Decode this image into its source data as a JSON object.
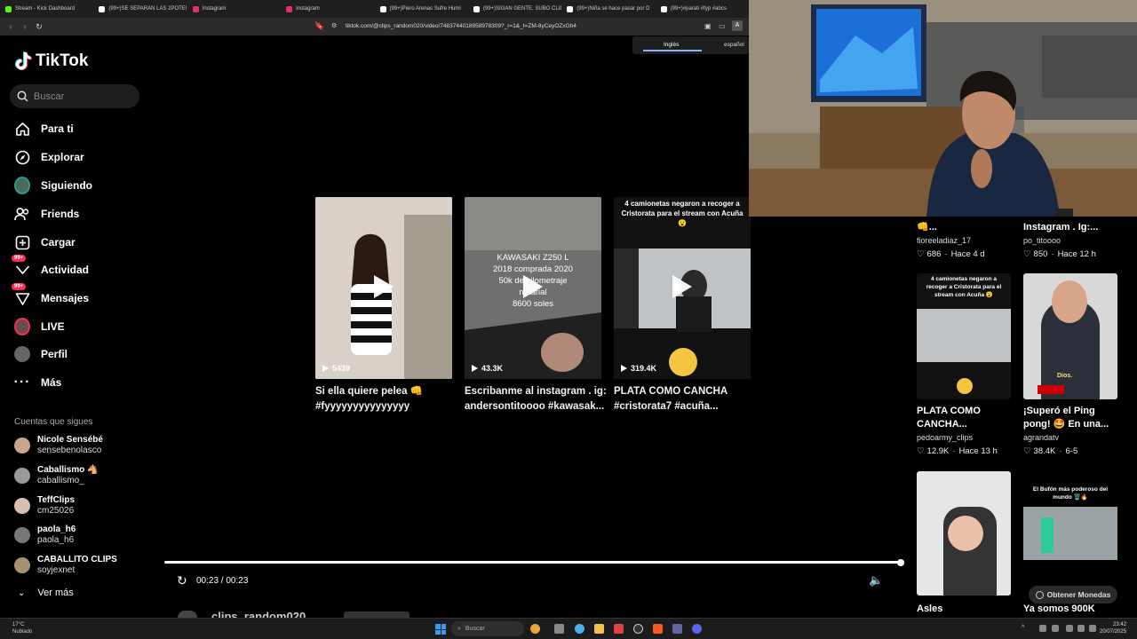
{
  "browser": {
    "tabs": [
      {
        "label": "Stream - Kick Dashboard",
        "color": "#53fc18"
      },
      {
        "label": "(99+)SE SEPARAN LAS 2POTE!!",
        "color": "#ffffff"
      },
      {
        "label": "Instagram",
        "color": "#e1306c"
      },
      {
        "label": "Instagram",
        "color": "#e1306c"
      },
      {
        "label": "(99+)Piero Arenas Sufre Humi",
        "color": "#ffffff"
      },
      {
        "label": "(99+)SIGAN GENTE, SUBO CLIP",
        "color": "#ffffff"
      },
      {
        "label": "(99+)Niña se hace pasar por D",
        "color": "#ffffff"
      },
      {
        "label": "(99+)#parati #fyp #abcs",
        "color": "#ffffff"
      }
    ],
    "url": "tiktok.com/@clips_random020/video/7483744018958978309?_r=1&_t=ZM-8yCeyOZxGh4",
    "translate": {
      "lang1": "Inglés",
      "lang2": "español"
    }
  },
  "sidebar": {
    "logo": "TikTok",
    "search_placeholder": "Buscar",
    "nav": [
      {
        "label": "Para ti",
        "icon": "home-icon"
      },
      {
        "label": "Explorar",
        "icon": "compass-icon"
      },
      {
        "label": "Siguiendo",
        "icon": "following-avatar-icon"
      },
      {
        "label": "Friends",
        "icon": "friends-icon"
      },
      {
        "label": "Cargar",
        "icon": "upload-icon"
      },
      {
        "label": "Actividad",
        "icon": "activity-icon",
        "badge": "99+"
      },
      {
        "label": "Mensajes",
        "icon": "messages-icon",
        "badge": "99+"
      },
      {
        "label": "LIVE",
        "icon": "live-icon"
      },
      {
        "label": "Perfil",
        "icon": "profile-icon"
      },
      {
        "label": "Más",
        "icon": "more-icon"
      }
    ],
    "following_title": "Cuentas que sigues",
    "following": [
      {
        "name": "Nicole Sensébé",
        "handle": "sensebenolasco",
        "color": "#c9a58a"
      },
      {
        "name": "Caballismo 🐴",
        "handle": "caballismo_",
        "color": "#9a9a9a"
      },
      {
        "name": "TeffClips",
        "handle": "cm25026",
        "color": "#d8c0b0"
      },
      {
        "name": "paola_h6",
        "handle": "paola_h6",
        "color": "#777777"
      },
      {
        "name": "CABALLITO CLIPS",
        "handle": "soyjexnet",
        "color": "#a89070"
      }
    ],
    "see_more": "Ver más"
  },
  "videos": [
    {
      "views": "5439",
      "caption": "Si ella quiere pelea 👊 #fyyyyyyyyyyyyyyy",
      "bg": "#d9d1c8"
    },
    {
      "views": "43.3K",
      "caption": "Escribanme al instagram . ig: andersontitoooo #kawasak...",
      "bg": "#6f6f6f",
      "overlay": "KAWASAKI Z250 L\n2018 comprada 2020\n50k de kilometraje\nnotarial\n8600 soles"
    },
    {
      "views": "319.4K",
      "caption": "PLATA COMO CANCHA #cristorata7 #acuña...",
      "bg": "#111111",
      "overlay": "4 camionetas negaron a recoger a Cristorata para el stream con Acuña 😮"
    }
  ],
  "player": {
    "time": "00:23 / 00:23",
    "progress": 1.0,
    "author": "clips_random020"
  },
  "right_column": [
    {
      "title": "👊...",
      "user": "fioreeladiaz_17",
      "likes": "686",
      "ago": "Hace 4 d"
    },
    {
      "title": "Instagram . Ig:...",
      "user": "po_titoooo",
      "likes": "850",
      "ago": "Hace 12 h"
    },
    {
      "title": "PLATA COMO CANCHA...",
      "user": "pedoarmy_clips",
      "likes": "12.9K",
      "ago": "Hace 13 h",
      "overlay": "4 camionetas negaron a recoger a Cristorata para el stream con Acuña 😮"
    },
    {
      "title": "¡Superó el Ping pong! 🤩 En una...",
      "user": "agrandatv",
      "likes": "38.4K",
      "ago": "6-5",
      "overlay": "Dios."
    },
    {
      "title": "Asles"
    },
    {
      "title": "Ya somos 900K",
      "overlay": "El Bufón más poderoso del mundo 🗑️🔥"
    }
  ],
  "coins_button": "Obtener Monedas",
  "taskbar": {
    "weather_temp": "17°C",
    "weather_desc": "Nublado",
    "search": "Buscar",
    "time": "23:42",
    "date": "20/07/2025"
  }
}
